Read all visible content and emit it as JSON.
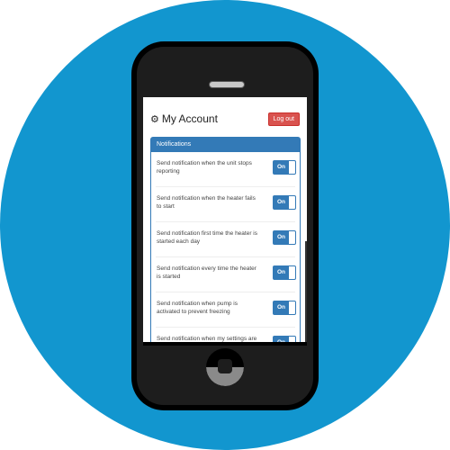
{
  "colors": {
    "background_circle": "#1296cf",
    "primary": "#337ab7",
    "danger": "#d9534f",
    "phone_body": "#1d1d1d"
  },
  "header": {
    "icon": "gear-icon",
    "title": "My Account",
    "logout_label": "Log out"
  },
  "panel": {
    "heading": "Notifications",
    "items": [
      {
        "label": "Send notification when the unit stops reporting",
        "toggle": "On"
      },
      {
        "label": "Send notification when the heater fails to start",
        "toggle": "On"
      },
      {
        "label": "Send notification first time the heater is started each day",
        "toggle": "On"
      },
      {
        "label": "Send notification every time the heater is started",
        "toggle": "On"
      },
      {
        "label": "Send notification when pump is activated to prevent freezing",
        "toggle": "On"
      },
      {
        "label": "Send notification when my settings are modified by my dealer",
        "toggle": "On"
      }
    ]
  }
}
